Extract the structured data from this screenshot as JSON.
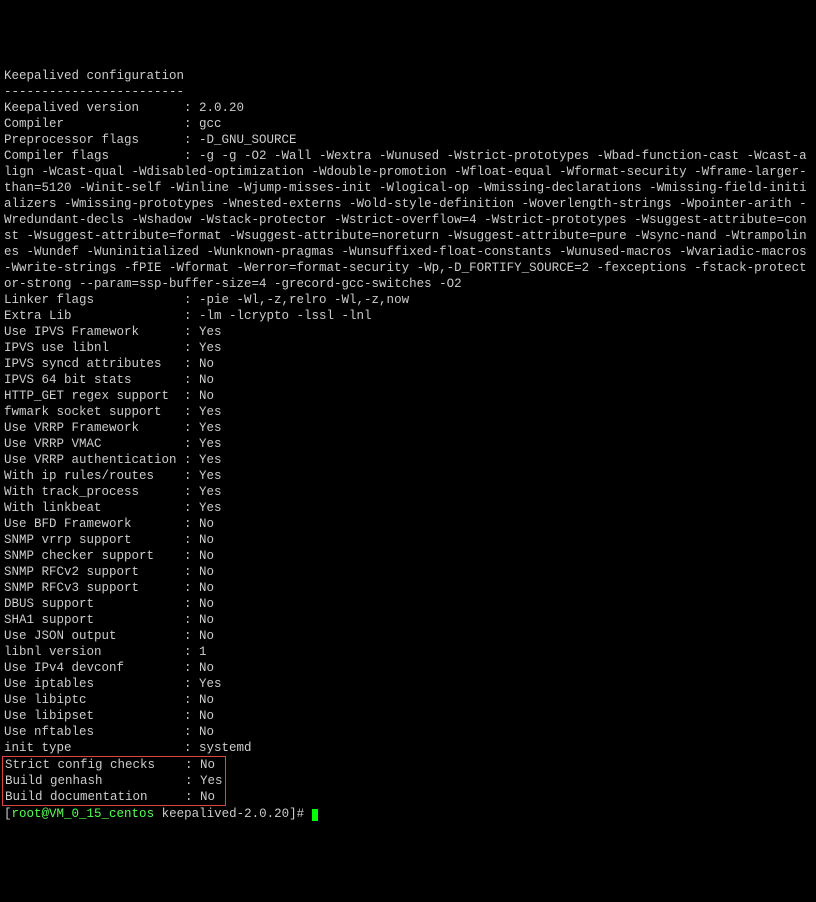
{
  "header": {
    "title": "Keepalived configuration",
    "sep": "------------------------"
  },
  "kv1": [
    {
      "key": "Keepalived version",
      "value": "2.0.20"
    },
    {
      "key": "Compiler",
      "value": "gcc"
    },
    {
      "key": "Preprocessor flags",
      "value": "-D_GNU_SOURCE"
    }
  ],
  "compilerFlagsKey": "Compiler flags",
  "compilerFlags": "-g -g -O2 -Wall -Wextra -Wunused -Wstrict-prototypes -Wbad-function-cast -Wcast-align -Wcast-qual -Wdisabled-optimization -Wdouble-promotion -Wfloat-equal -Wformat-security -Wframe-larger-than=5120 -Winit-self -Winline -Wjump-misses-init -Wlogical-op -Wmissing-declarations -Wmissing-field-initializers -Wmissing-prototypes -Wnested-externs -Wold-style-definition -Woverlength-strings -Wpointer-arith -Wredundant-decls -Wshadow -Wstack-protector -Wstrict-overflow=4 -Wstrict-prototypes -Wsuggest-attribute=const -Wsuggest-attribute=format -Wsuggest-attribute=noreturn -Wsuggest-attribute=pure -Wsync-nand -Wtrampolines -Wundef -Wuninitialized -Wunknown-pragmas -Wunsuffixed-float-constants -Wunused-macros -Wvariadic-macros -Wwrite-strings -fPIE -Wformat -Werror=format-security -Wp,-D_FORTIFY_SOURCE=2 -fexceptions -fstack-protector-strong --param=ssp-buffer-size=4 -grecord-gcc-switches -O2",
  "kv2": [
    {
      "key": "Linker flags",
      "value": "-pie -Wl,-z,relro -Wl,-z,now"
    },
    {
      "key": "Extra Lib",
      "value": "-lm -lcrypto -lssl -lnl"
    },
    {
      "key": "Use IPVS Framework",
      "value": "Yes"
    },
    {
      "key": "IPVS use libnl",
      "value": "Yes"
    },
    {
      "key": "IPVS syncd attributes",
      "value": "No"
    },
    {
      "key": "IPVS 64 bit stats",
      "value": "No"
    },
    {
      "key": "HTTP_GET regex support",
      "value": "No"
    },
    {
      "key": "fwmark socket support",
      "value": "Yes"
    },
    {
      "key": "Use VRRP Framework",
      "value": "Yes"
    },
    {
      "key": "Use VRRP VMAC",
      "value": "Yes"
    },
    {
      "key": "Use VRRP authentication",
      "value": "Yes"
    },
    {
      "key": "With ip rules/routes",
      "value": "Yes"
    },
    {
      "key": "With track_process",
      "value": "Yes"
    },
    {
      "key": "With linkbeat",
      "value": "Yes"
    },
    {
      "key": "Use BFD Framework",
      "value": "No"
    },
    {
      "key": "SNMP vrrp support",
      "value": "No"
    },
    {
      "key": "SNMP checker support",
      "value": "No"
    },
    {
      "key": "SNMP RFCv2 support",
      "value": "No"
    },
    {
      "key": "SNMP RFCv3 support",
      "value": "No"
    },
    {
      "key": "DBUS support",
      "value": "No"
    },
    {
      "key": "SHA1 support",
      "value": "No"
    },
    {
      "key": "Use JSON output",
      "value": "No"
    },
    {
      "key": "libnl version",
      "value": "1"
    },
    {
      "key": "Use IPv4 devconf",
      "value": "No"
    },
    {
      "key": "Use iptables",
      "value": "Yes"
    },
    {
      "key": "Use libiptc",
      "value": "No"
    },
    {
      "key": "Use libipset",
      "value": "No"
    },
    {
      "key": "Use nftables",
      "value": "No"
    },
    {
      "key": "init type",
      "value": "systemd"
    }
  ],
  "boxed": [
    {
      "key": "Strict config checks",
      "value": "No"
    },
    {
      "key": "Build genhash",
      "value": "Yes"
    },
    {
      "key": "Build documentation",
      "value": "No"
    }
  ],
  "prompt": {
    "user": "root",
    "at": "@",
    "host": "VM_0_15_centos",
    "path": "keepalived-2.0.20",
    "open": "[",
    "close": "]#"
  }
}
